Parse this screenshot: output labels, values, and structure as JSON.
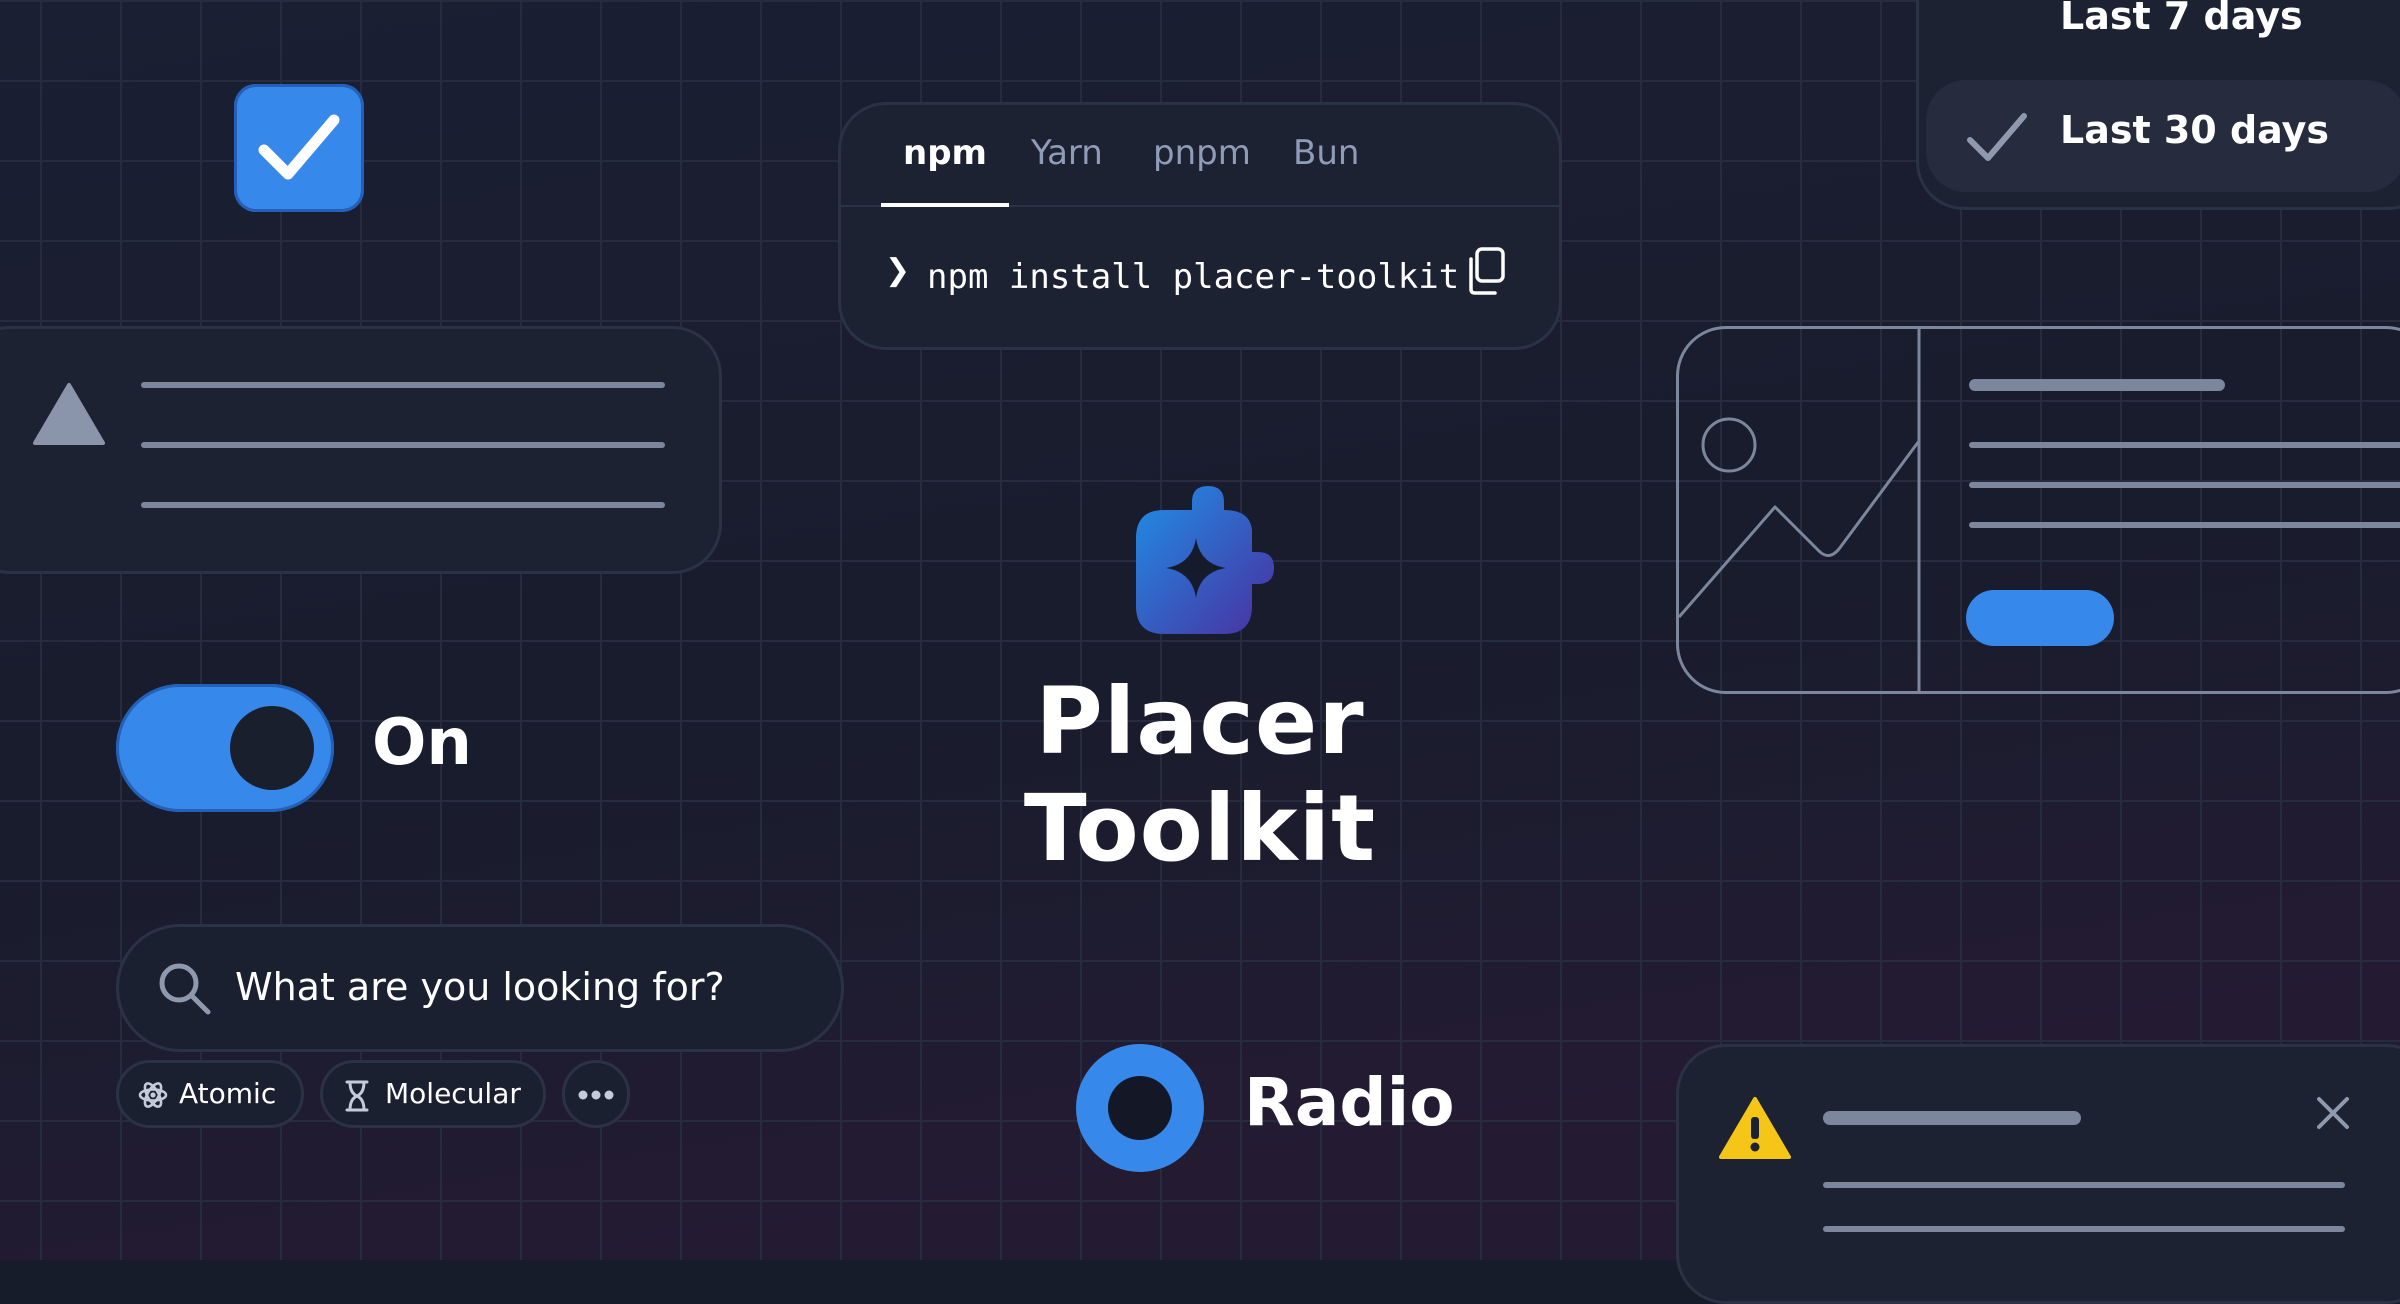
{
  "install": {
    "tabs": [
      {
        "label": "npm",
        "active": true
      },
      {
        "label": "Yarn",
        "active": false
      },
      {
        "label": "pnpm",
        "active": false
      },
      {
        "label": "Bun",
        "active": false
      }
    ],
    "prompt": "❯",
    "command": "npm install placer-toolkit",
    "copy_icon": "copy-icon"
  },
  "dropdown": {
    "options": [
      {
        "label": "Last 7 days",
        "selected": false
      },
      {
        "label": "Last 30 days",
        "selected": true
      }
    ]
  },
  "toggle": {
    "label": "On",
    "checked": true
  },
  "search": {
    "placeholder": "What are you looking for?"
  },
  "chips": [
    {
      "label": "Atomic",
      "icon": "atom-icon"
    },
    {
      "label": "Molecular",
      "icon": "hourglass-icon"
    },
    {
      "label": "",
      "icon": "more-icon"
    }
  ],
  "brand": {
    "title": "Placer Toolkit",
    "logo": "puzzle-sparkle-icon"
  },
  "radio": {
    "label": "Radio",
    "checked": true
  },
  "colors": {
    "accent": "#3689ea",
    "background": "#171c2b",
    "card": "#1d2232",
    "warning": "#f5c518"
  }
}
